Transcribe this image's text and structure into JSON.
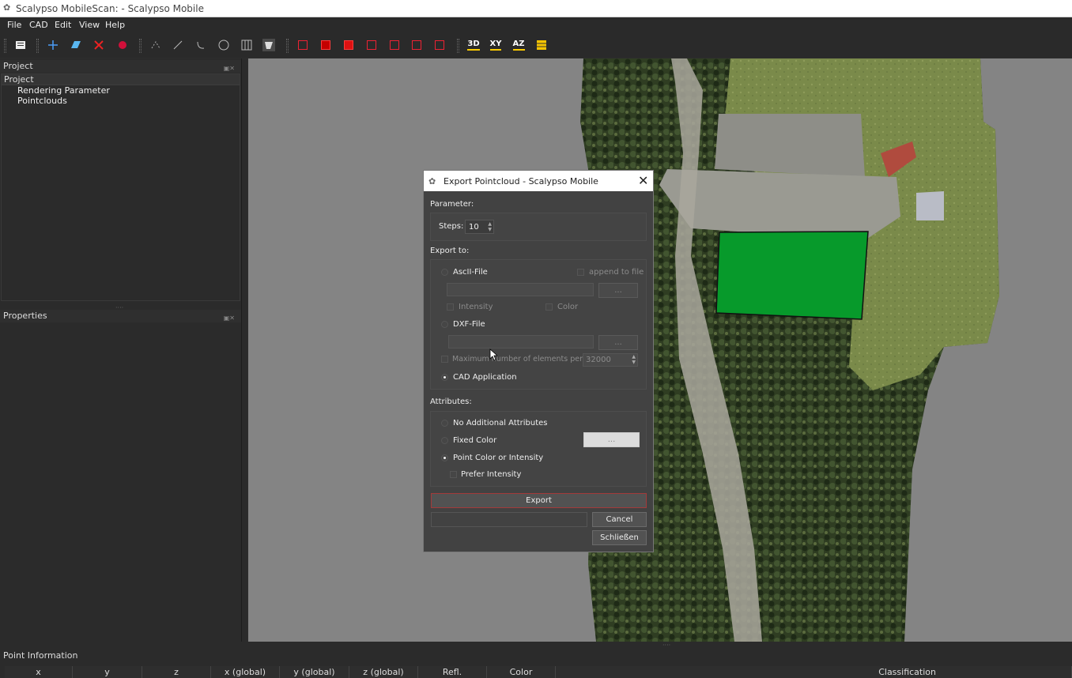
{
  "window": {
    "title": "Scalypso MobileScan:  - Scalypso Mobile"
  },
  "menu": [
    "File",
    "CAD",
    "Edit",
    "View",
    "Help"
  ],
  "panels": {
    "project_dock_title": "Project",
    "tree_header": "Project",
    "tree_items": [
      "Rendering Parameter",
      "Pointclouds"
    ],
    "properties_dock_title": "Properties",
    "point_info_title": "Point Information"
  },
  "toolbar_icons": {
    "axis3d": "3D",
    "axisxy": "XY",
    "axisaz": "AZ"
  },
  "point_info_columns": [
    "x",
    "y",
    "z",
    "x (global)",
    "y (global)",
    "z (global)",
    "Refl.",
    "Color",
    "Classification"
  ],
  "dialog": {
    "title": "Export Pointcloud - Scalypso Mobile",
    "parameter_label": "Parameter:",
    "steps_label": "Steps:",
    "steps_value": "10",
    "export_to_label": "Export to:",
    "ascii_file": "AscII-File",
    "append_to_file": "append to file",
    "browse": "...",
    "intensity": "Intensity",
    "color": "Color",
    "dxf_file": "DXF-File",
    "max_elements": "Maximum number of elements per file",
    "max_elements_value": "32000",
    "cad_application": "CAD Application",
    "attributes_label": "Attributes:",
    "no_additional": "No Additional Attributes",
    "fixed_color": "Fixed Color",
    "point_color": "Point Color or Intensity",
    "prefer_intensity": "Prefer Intensity",
    "export_button": "Export",
    "cancel_button": "Cancel",
    "close_button": "Schließen",
    "selected_target": "CAD Application",
    "selected_attribute": "Point Color or Intensity"
  },
  "colors": {
    "accent_red": "#c40000",
    "selection_green": "#079a2b",
    "export_border": "#a33a3a"
  }
}
